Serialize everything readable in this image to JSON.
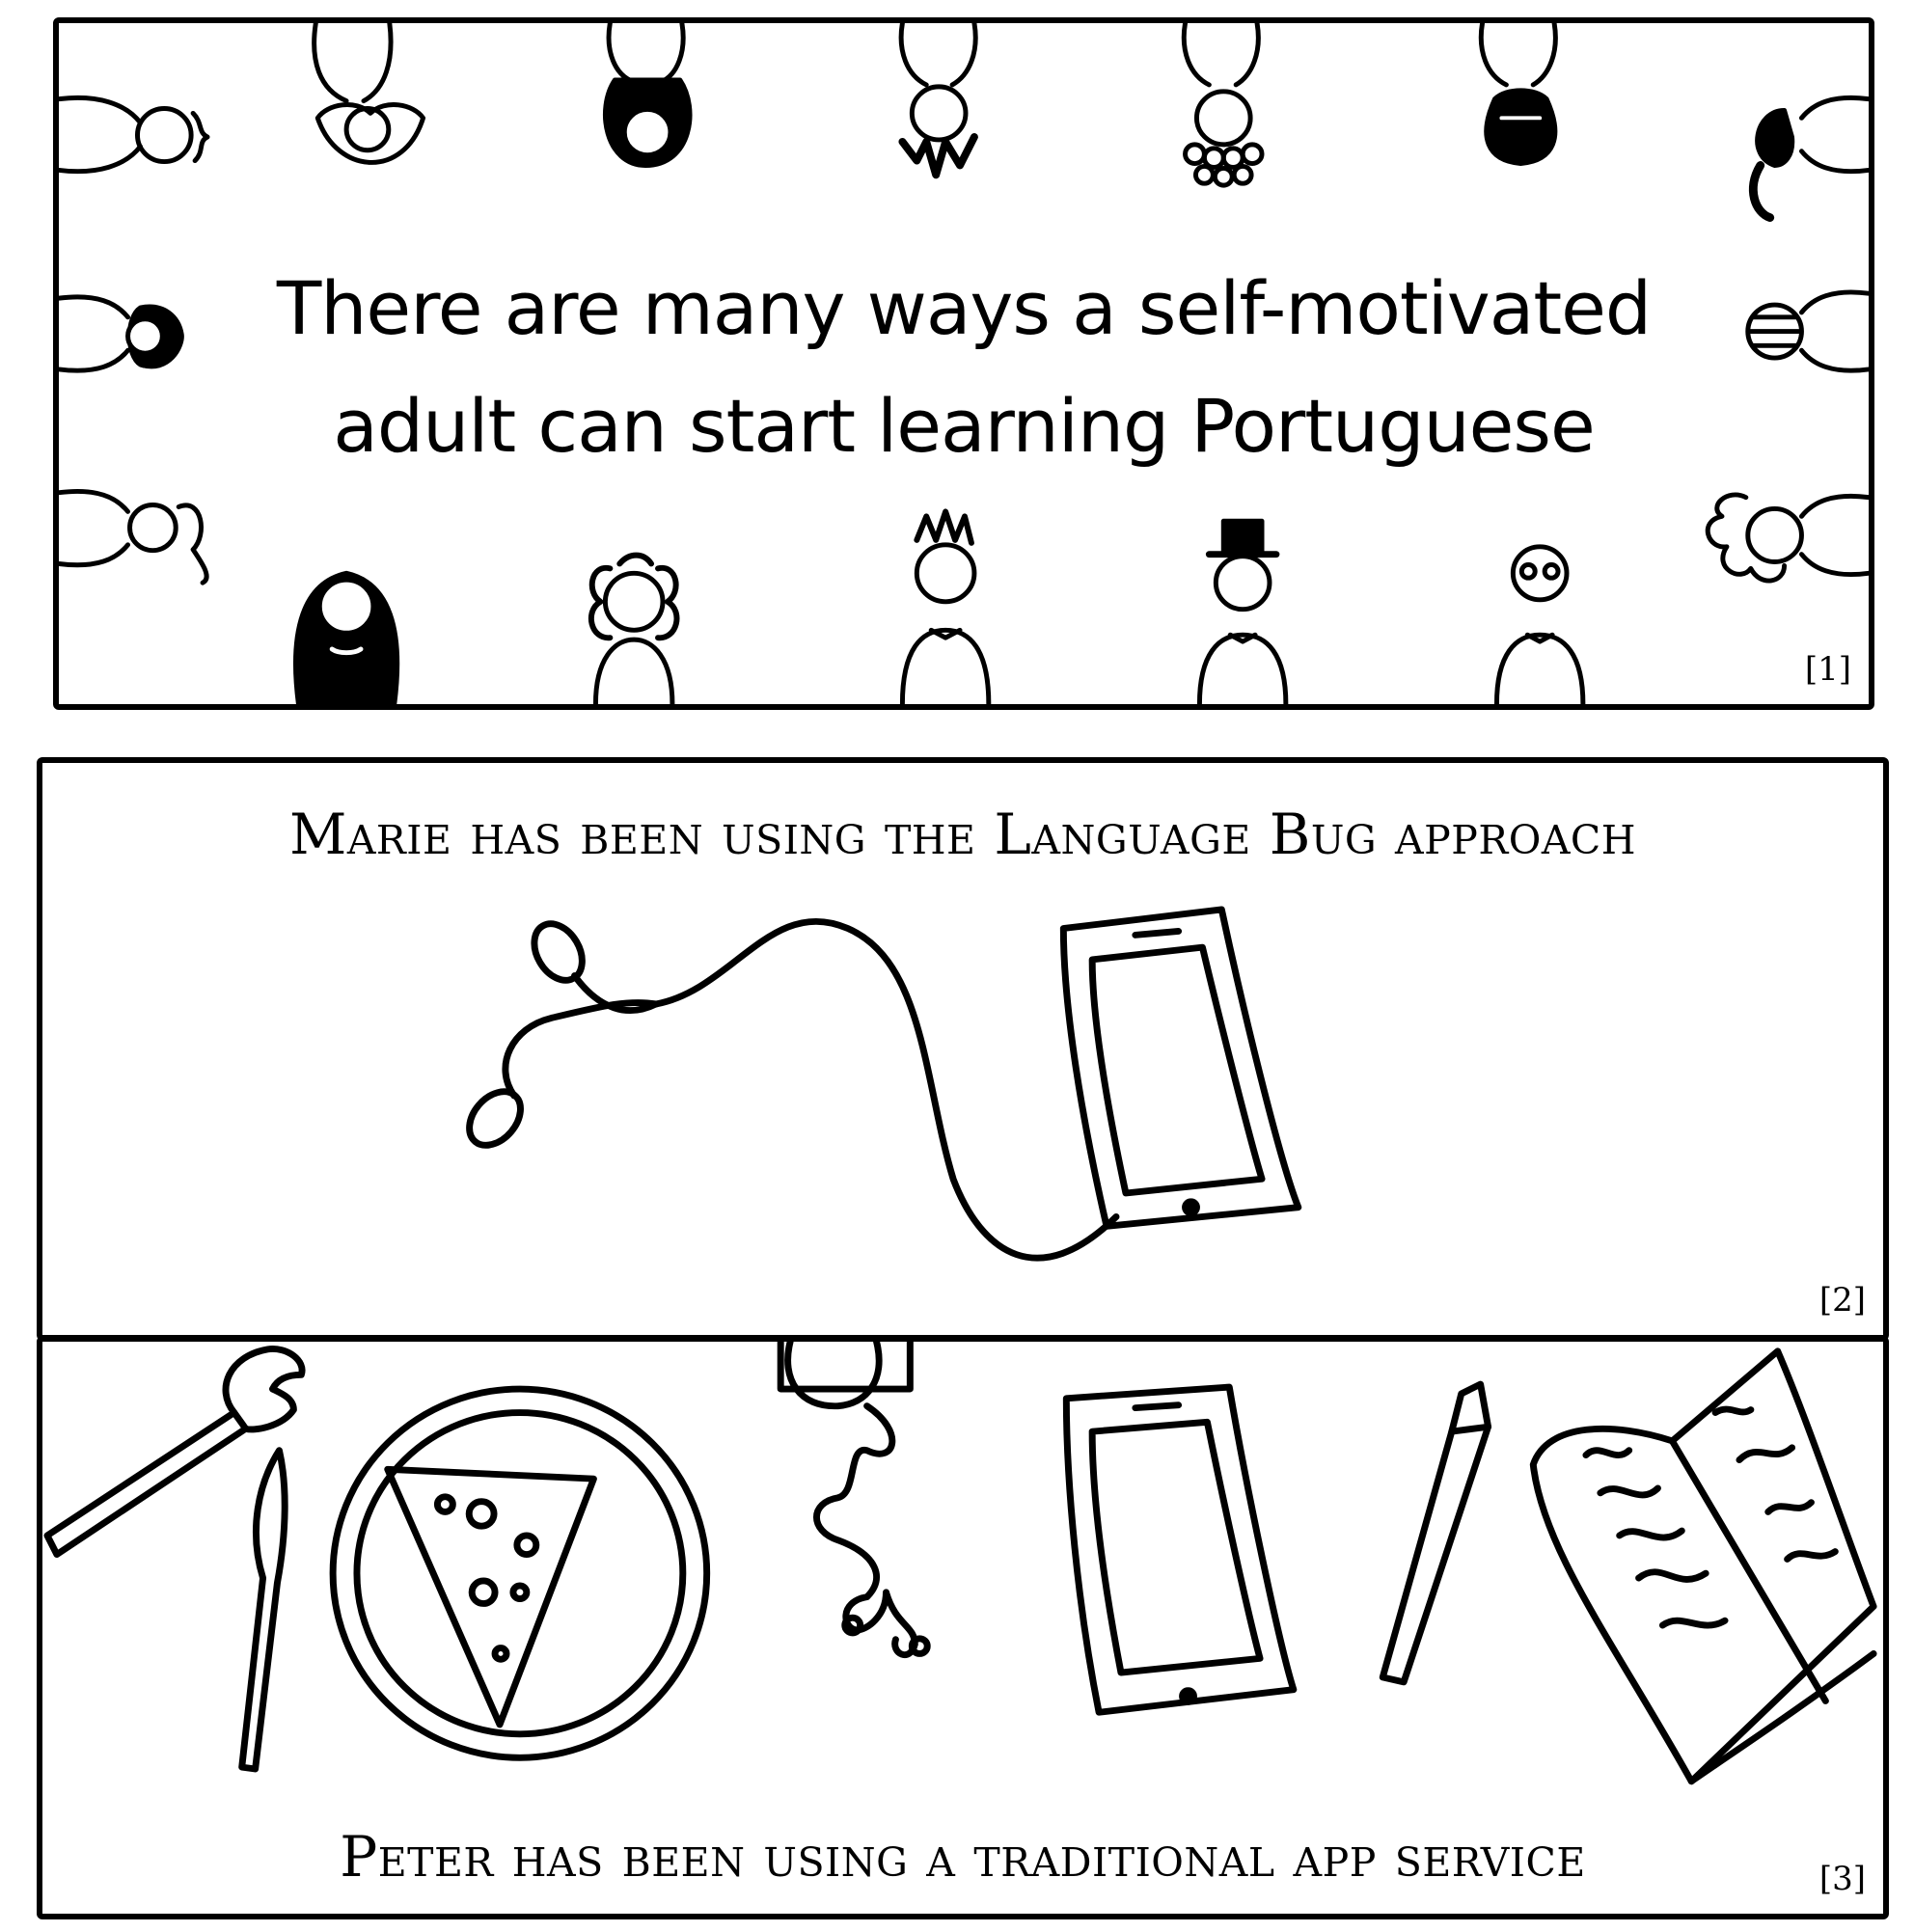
{
  "panels": [
    {
      "number": "[1]",
      "headline_line1": "There are many ways a self-motivated",
      "headline_line2": "adult can start learning Portuguese"
    },
    {
      "number": "[2]",
      "caption": "Marie has been using the Language Bug approach"
    },
    {
      "number": "[3]",
      "caption": "Peter has been using a traditional app service"
    }
  ],
  "colors": {
    "ink": "#000000",
    "paper": "#ffffff"
  }
}
